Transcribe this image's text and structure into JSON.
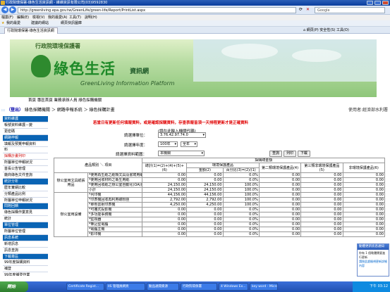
{
  "window": {
    "title": "行政院環保署-綠色生活資訊網 - 維維資訊有限公司(03)9592830"
  },
  "browser": {
    "url": "http://greenliving.epa.gov.tw/GreenLife/green-life/Report/PrintList.aspx",
    "search_placeholder": "Google",
    "menu": [
      "檔案(F)",
      "編輯(E)",
      "檢視(V)",
      "我的最愛(A)",
      "工具(T)",
      "說明(H)"
    ],
    "favorites_label": "我的最愛",
    "fav_items": [
      "建議的網站",
      "網頁快訊圖庫"
    ],
    "tab_label": "行政院環保署-綠色生活資訊網",
    "toolbar_tools": [
      "網頁(P)",
      "安全性(S)",
      "工具(O)"
    ]
  },
  "banner": {
    "org": "行政院環境保護署",
    "title": "綠色生活",
    "subtitle": "資訊網",
    "english": "GreenLiving Information Platform"
  },
  "breadcrumb": {
    "text": "首頁 專區首頁 業務承辦人員 綠色採購機關"
  },
  "nav": {
    "logout": "（登出）",
    "path": "綠色採購機關 ＞ 網路申報系統 ＞ 綠色採購計畫",
    "user": "使用者:經濟部水利署"
  },
  "sidebar": [
    {
      "label": "資料維護",
      "header": true
    },
    {
      "label": "帳號資料維護－變",
      "header": false
    },
    {
      "label": "更密碼",
      "header": false
    },
    {
      "label": "網路申報",
      "header": true
    },
    {
      "label": "填報及預覽申報資料",
      "header": false
    },
    {
      "label": "料",
      "header": false
    },
    {
      "label": "採購計畫列印",
      "header": false,
      "selected": true
    },
    {
      "label": "所屬單位申報狀況",
      "header": false
    },
    {
      "label": "首長公告管理",
      "header": false
    },
    {
      "label": "廠商綠色文件查詢",
      "header": false
    },
    {
      "label": "統計分析",
      "header": true
    },
    {
      "label": "歷年實績比較",
      "header": false
    },
    {
      "label": "分類產品比例",
      "header": false
    },
    {
      "label": "所屬單位申報狀況",
      "header": false
    },
    {
      "label": "問題回饋",
      "header": true
    },
    {
      "label": "綠色採購作業意見",
      "header": false
    },
    {
      "label": "統計",
      "header": false
    },
    {
      "label": "單位管理",
      "header": true
    },
    {
      "label": "所屬單位管理",
      "header": false
    },
    {
      "label": "訊息系統",
      "header": true
    },
    {
      "label": "新增訊息",
      "header": false
    },
    {
      "label": "訊息查詢",
      "header": false
    },
    {
      "label": "下載專區",
      "header": true
    },
    {
      "label": "99年度採購資料",
      "header": false
    },
    {
      "label": "補登",
      "header": false
    },
    {
      "label": "99年度補登作業",
      "header": false
    }
  ],
  "form": {
    "warning": "若當日有更新任何填報資料，或是確認採購資料，存查表報皆須一天排程更新才是正確資料",
    "unit_label": "請選擇單位：",
    "unit_hint": "(請在此輸入機關代碼)",
    "unit_value": "3.76.42.97.74.0",
    "year_label": "請選擇年度：",
    "year_value": "100年",
    "period_value": "全年",
    "scope_label": "請選擇資料範圍：",
    "scope_value": "本機關",
    "btn_query": "查詢",
    "btn_print": "列印",
    "btn_download": "下載"
  },
  "table": {
    "headers": {
      "category": "產品類別 ＼ 項目",
      "amount_group": "採購總金額",
      "total": "總計(1)=(2)+(4)+(5)+(6)",
      "label1": "環境保護產品",
      "amount2": "金額(2)",
      "pct3": "百分比(3)=(2)/(1)",
      "type2": "第二類環境保護產品(4)",
      "type3": "第三類非環境保護產品(5)",
      "nongreen": "非環境保護產品(6)"
    },
    "groups": [
      {
        "name": "辦公室用文具紙張用品",
        "rows": [
          {
            "item": "*使用再生紙之紙類文具及書寫用紙",
            "v": [
              "0.00",
              "0.00",
              "0.0%",
              "0.00",
              "0.00",
              "0.00"
            ]
          },
          {
            "item": "*使用回收材料之衛生用紙",
            "v": [
              "0.00",
              "0.00",
              "0.0%",
              "0.00",
              "0.00",
              "0.00"
            ]
          },
          {
            "item": "*使用回收紙之辦公室自動化(OA)用紙",
            "v": [
              "24,150.00",
              "24,150.00",
              "100.0%",
              "0.00",
              "0.00",
              "0.00"
            ]
          },
          {
            "item": "小計",
            "v": [
              "24,150.00",
              "24,150.00",
              "100.0%",
              "0.00",
              "0.00",
              "0.00"
            ]
          }
        ]
      },
      {
        "name": "辦公室用設備",
        "rows": [
          {
            "item": "*列印機",
            "v": [
              "44,156.00",
              "44,156.00",
              "100.0%",
              "0.00",
              "0.00",
              "0.00"
            ]
          },
          {
            "item": "*印表機回收再利用碳粉匣",
            "v": [
              "2,792.00",
              "2,792.00",
              "100.0%",
              "0.00",
              "0.00",
              "0.00"
            ]
          },
          {
            "item": "*單色雷射印表機",
            "v": [
              "4,250.00",
              "4,250.00",
              "100.0%",
              "0.00",
              "0.00",
              "0.00"
            ]
          },
          {
            "item": "*可攜式投影機",
            "v": [
              "0.00",
              "0.00",
              "0.0%",
              "0.00",
              "0.00",
              "0.00"
            ]
          },
          {
            "item": "*多功能事務機",
            "v": [
              "0.00",
              "0.00",
              "0.0%",
              "0.00",
              "0.00",
              "0.00"
            ]
          },
          {
            "item": "*監視器",
            "v": [
              "0.00",
              "0.00",
              "0.0%",
              "0.00",
              "0.00",
              "0.00"
            ]
          },
          {
            "item": "*筆記型電腦",
            "v": [
              "0.00",
              "0.00",
              "0.0%",
              "0.00",
              "0.00",
              "0.00"
            ]
          },
          {
            "item": "*電腦主機",
            "v": [
              "0.00",
              "0.00",
              "0.0%",
              "0.00",
              "0.00",
              "0.00"
            ]
          },
          {
            "item": "*影印機",
            "v": [
              "0.00",
              "0.00",
              "0.0%",
              "0.00",
              "0.00",
              "0.00"
            ]
          }
        ]
      }
    ]
  },
  "popup": {
    "title": "動體更新訊息通知",
    "body": "你有 1 個軟體需要進行更新",
    "link": "請按此處檢視更新詳細內容"
  },
  "taskbar": {
    "start": "開始",
    "tasks": [
      "Certificate Regist...",
      "IIS 管理員網頁",
      "動品通開資源",
      "行政院環保署",
      "4 Windows Ex...",
      "key word - Micro..."
    ],
    "clock": "下午 03:12"
  },
  "colors": {
    "accent": "#0a64b4",
    "warning": "#e00000",
    "banner": "#1e8a28"
  }
}
